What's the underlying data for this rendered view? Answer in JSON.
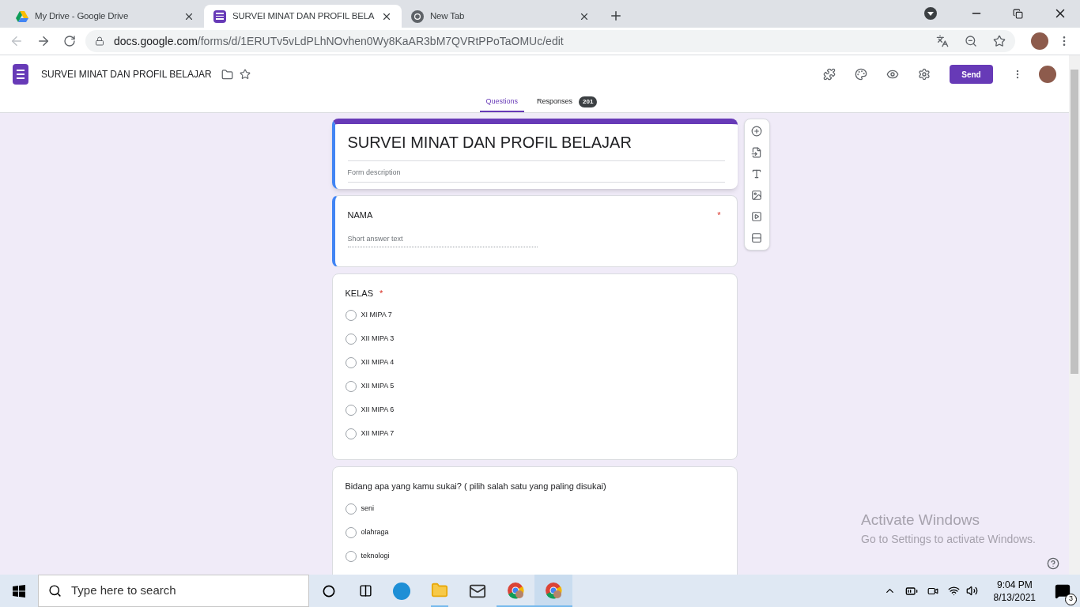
{
  "browser": {
    "tabs": [
      {
        "title": "My Drive - Google Drive",
        "kind": "drive",
        "selected": false
      },
      {
        "title": "SURVEI MINAT DAN PROFIL BELA",
        "kind": "forms",
        "selected": true
      },
      {
        "title": "New Tab",
        "kind": "chrome",
        "selected": false
      }
    ],
    "address": {
      "domain": "docs.google.com",
      "path": "/forms/d/1ERUTv5vLdPLhNOvhen0Wy8KaAR3bM7QVRtPPoTaOMUc/edit"
    }
  },
  "header": {
    "doc_title": "SURVEI MINAT DAN PROFIL BELAJAR",
    "send_label": "Send",
    "tabs": [
      {
        "label": "Questions",
        "selected": true
      },
      {
        "label": "Responses",
        "count": "201",
        "selected": false
      }
    ]
  },
  "form": {
    "title": "SURVEI MINAT DAN PROFIL BELAJAR",
    "description_placeholder": "Form description",
    "focused": true,
    "questions": [
      {
        "kind": "short_answer",
        "title": "NAMA",
        "required": "*",
        "focused": true,
        "placeholder": "Short answer text"
      },
      {
        "kind": "multiple_choice",
        "title": "KELAS",
        "required": "*",
        "focused": false,
        "options": [
          {
            "label": "XI MIPA 7",
            "checked": false
          },
          {
            "label": "XII MIPA 3",
            "checked": false
          },
          {
            "label": "XII MIPA 4",
            "checked": false
          },
          {
            "label": "XII MIPA 5",
            "checked": false
          },
          {
            "label": "XII MIPA 6",
            "checked": false
          },
          {
            "label": "XII MIPA 7",
            "checked": false
          }
        ]
      },
      {
        "kind": "multiple_choice",
        "title": "Bidang apa yang kamu sukai? ( pilih salah satu yang paling disukai)",
        "focused": false,
        "options": [
          {
            "label": "seni",
            "checked": false
          },
          {
            "label": "olahraga",
            "checked": false
          },
          {
            "label": "teknologi",
            "checked": false
          }
        ]
      }
    ]
  },
  "windows_notice": {
    "title": "Activate Windows",
    "subtitle": "Go to Settings to activate Windows."
  },
  "taskbar": {
    "search_placeholder": "Type here to search",
    "time": "9:04 PM",
    "date": "8/13/2021",
    "notifications": "3"
  }
}
